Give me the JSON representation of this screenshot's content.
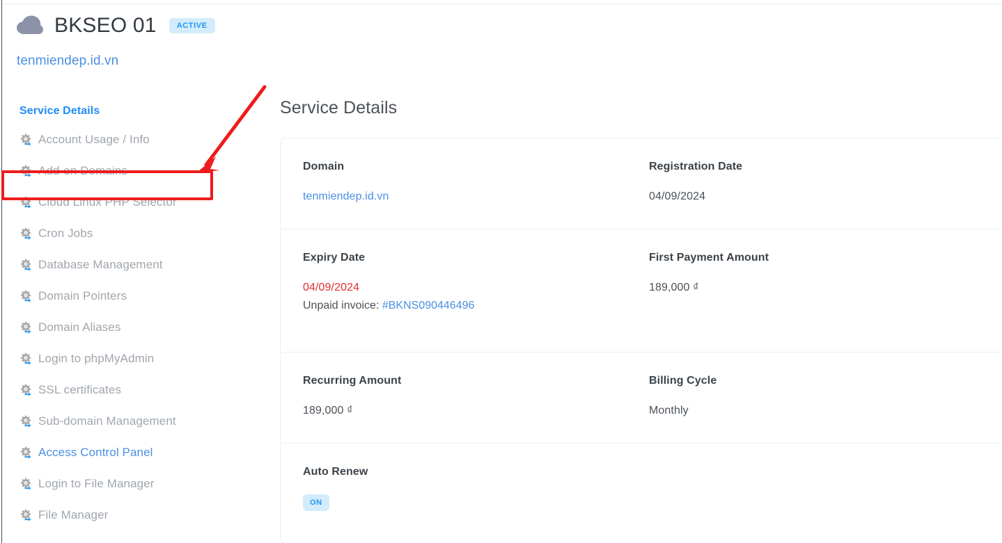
{
  "header": {
    "cloud_icon": "cloud-icon",
    "title": "BKSEO 01",
    "status_badge": "ACTIVE",
    "domain_link": "tenmiendep.id.vn"
  },
  "sidebar": {
    "heading": "Service Details",
    "items": [
      {
        "label": "Account Usage / Info",
        "icon": "gear-arrow-icon",
        "accent": false
      },
      {
        "label": "Add-on Domains",
        "icon": "gear-arrow-icon",
        "accent": false,
        "highlighted": true
      },
      {
        "label": "Cloud Linux PHP Selector",
        "icon": "gear-arrow-icon",
        "accent": false
      },
      {
        "label": "Cron Jobs",
        "icon": "gear-arrow-icon",
        "accent": false
      },
      {
        "label": "Database Management",
        "icon": "gear-arrow-icon",
        "accent": false
      },
      {
        "label": "Domain Pointers",
        "icon": "gear-arrow-icon",
        "accent": false
      },
      {
        "label": "Domain Aliases",
        "icon": "gear-arrow-icon",
        "accent": false
      },
      {
        "label": "Login to phpMyAdmin",
        "icon": "gear-arrow-icon",
        "accent": false
      },
      {
        "label": "SSL certificates",
        "icon": "gear-arrow-icon",
        "accent": false
      },
      {
        "label": "Sub-domain Management",
        "icon": "gear-arrow-icon",
        "accent": false
      },
      {
        "label": "Access Control Panel",
        "icon": "gear-arrow-icon",
        "accent": true
      },
      {
        "label": "Login to File Manager",
        "icon": "gear-arrow-icon",
        "accent": false
      },
      {
        "label": "File Manager",
        "icon": "gear-arrow-icon",
        "accent": false
      }
    ]
  },
  "main": {
    "title": "Service Details",
    "rows": [
      {
        "left": {
          "label": "Domain",
          "value": "tenmiendep.id.vn",
          "is_link": true
        },
        "right": {
          "label": "Registration Date",
          "value": "04/09/2024"
        }
      },
      {
        "left": {
          "label": "Expiry Date",
          "value": "04/09/2024",
          "danger": true,
          "sub_prefix": "Unpaid invoice: ",
          "sub_link": "#BKNS090446496"
        },
        "right": {
          "label": "First Payment Amount",
          "value": "189,000 ₫"
        }
      },
      {
        "left": {
          "label": "Recurring Amount",
          "value": "189,000 ₫"
        },
        "right": {
          "label": "Billing Cycle",
          "value": "Monthly"
        }
      },
      {
        "left": {
          "label": "Auto Renew",
          "toggle_badge": "ON"
        },
        "right": {
          "label": "",
          "value": ""
        }
      }
    ]
  },
  "annotation": {
    "box_target": "Add-on Domains",
    "arrow_color": "#ee1c1c",
    "box_color": "#ee1c1c"
  },
  "colors": {
    "accent_blue": "#4b8fe2",
    "heading_blue": "#1e8bf5",
    "badge_bg": "#d3ecfb",
    "badge_text": "#2196f3",
    "danger_red": "#e03131",
    "muted_text": "#a0a6ad",
    "annotation_red": "#ee1c1c"
  }
}
